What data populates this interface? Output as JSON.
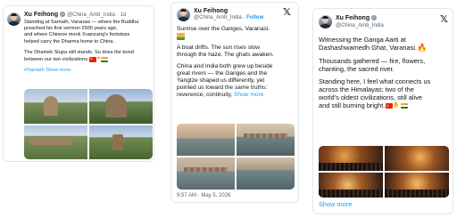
{
  "colors": {
    "link": "#1d9bf0",
    "text": "#0f1419",
    "muted": "#536471",
    "border": "#e1e8ed"
  },
  "icons": {
    "x_logo": "x-logo-icon",
    "verified": "verified-badge-icon",
    "flag_china": "flag-china-icon",
    "flag_india": "flag-india-icon",
    "sunrise": "sunrise-icon",
    "fire": "fire-icon"
  },
  "card1": {
    "author": "Xu Feihong",
    "handle": "@China_Amb_India",
    "time": "1d",
    "line1": "Standing at Sarnath, Varanasi — where the Buddha",
    "line2": "preached his first sermon 2500 years ago,",
    "line3": "and where Chinese monk Xuanzang's footsteps",
    "line4": "helped carry the Dharma home to China.",
    "line5": "The Dhamek Stupa still stands. So does the bond",
    "line6": "between our two civilizations.",
    "hashtag": "#Sarnath",
    "show_more": "Show more"
  },
  "card2": {
    "author": "Xu Feihong",
    "handle": "@China_Amb_India",
    "follow": "Follow",
    "line1": "Sunrise over the Ganges, Varanasi.",
    "line2": "A boat drifts. The sun rises slow",
    "line3": "through the haze. The ghats awaken.",
    "line4": "China and India both grew up beside",
    "line5": "great rivers — the Ganges and the",
    "line6": "Yangtze shaped us differently, yet",
    "line7": "pointed us toward the same truths:",
    "line8": "reverence, continuity,",
    "show_more": "Show more",
    "timestamp": "9:57 AM · May 5, 2026"
  },
  "card3": {
    "author": "Xu Feihong",
    "handle": "@China_Amb_India",
    "line1": "Witnessing the Ganga Aarti at",
    "line2": "Dashashwamedh Ghat, Varanasi.",
    "line3": "Thousands gathered — fire, flowers,",
    "line4": "chanting, the sacred river.",
    "line5": "Standing here, I feel what connects us",
    "line6": "across the Himalayas: two of the",
    "line7": "world's oldest civilizations, still alive",
    "line8": "and still burning bright.",
    "show_more": "Show more"
  }
}
